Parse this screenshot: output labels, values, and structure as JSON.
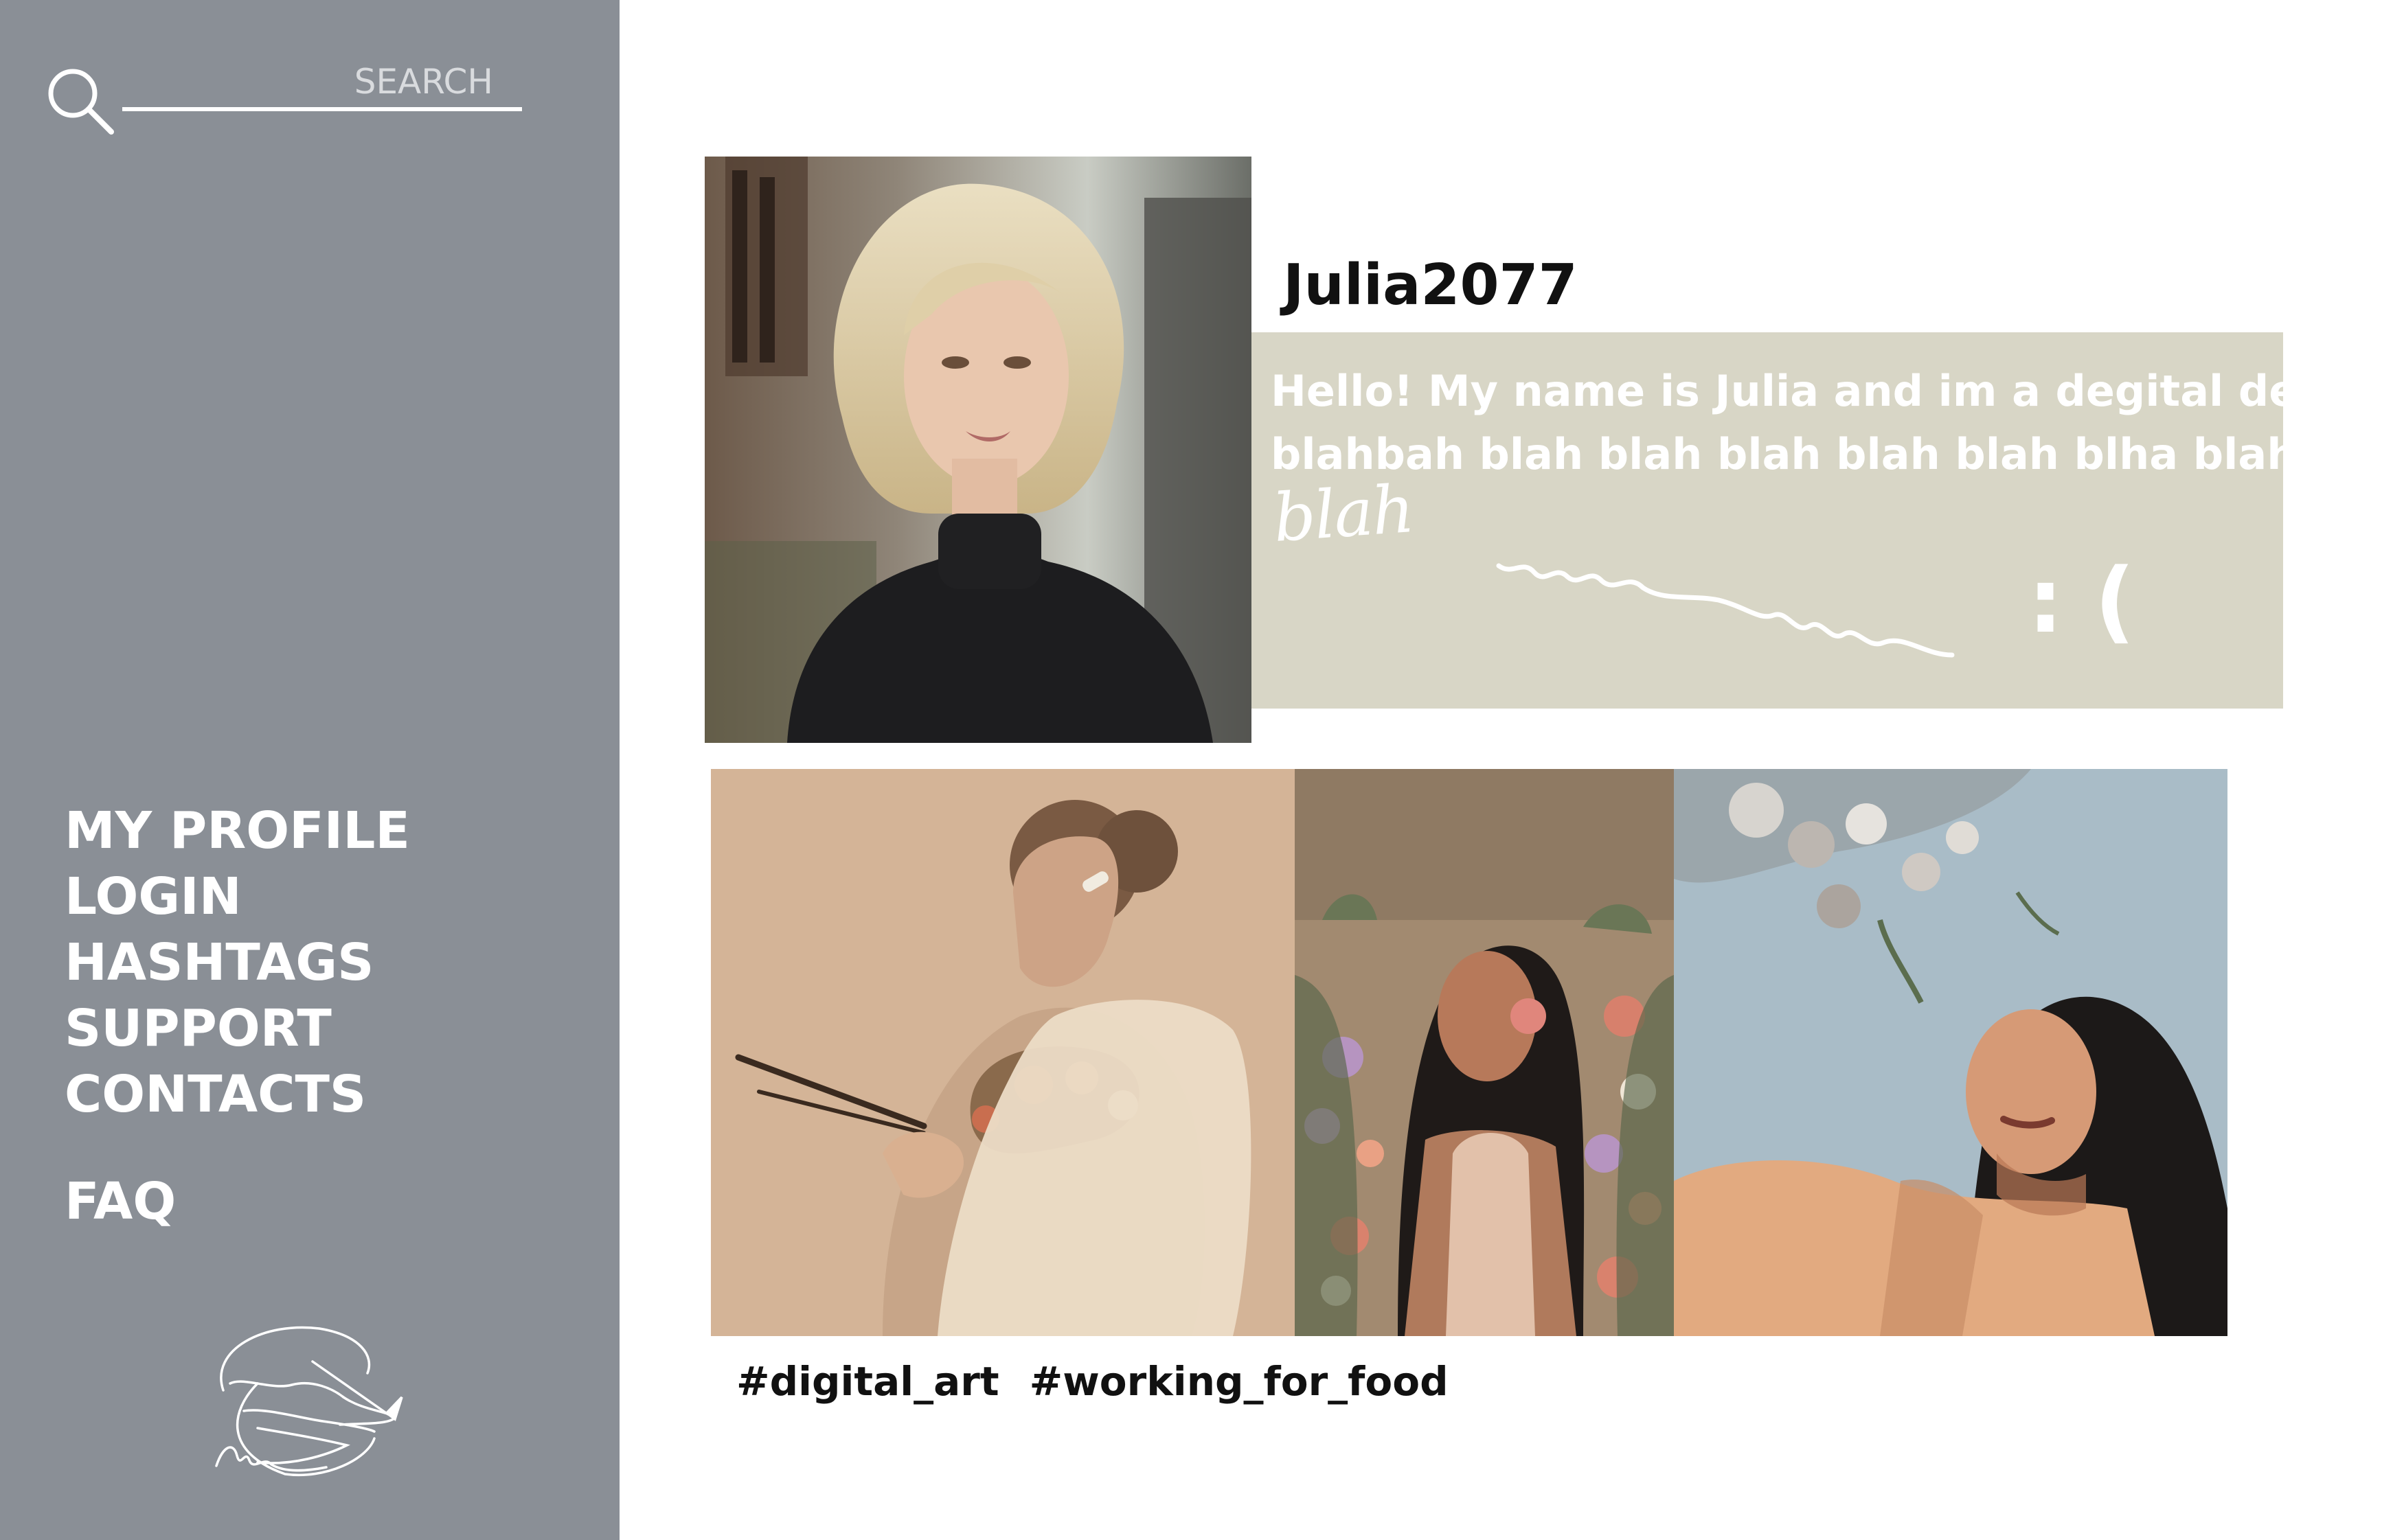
{
  "search": {
    "placeholder": "SEARCH"
  },
  "nav": {
    "items": [
      "MY PROFILE",
      "LOGIN",
      "HASHTAGS",
      "SUPPORT",
      "CONTACTS"
    ],
    "faq": "FAQ"
  },
  "profile": {
    "username": "Julia2077",
    "bio_line_1": "Hello! My name is Julia and im a degital designer!",
    "bio_line_2": "blahbah blah blah blah blah blah blha blahahajhf",
    "scribble": "blah",
    "emoticon": ": ("
  },
  "gallery": {
    "images": [
      "painter-illustration",
      "flower-girl-illustration",
      "sunlit-woman-illustration"
    ]
  },
  "hashtags": [
    "#digital_art",
    "#working_for_food"
  ],
  "colors": {
    "sidebar": "#8a8f96",
    "bio_box": "#d8d6c6",
    "text_dark": "#111111",
    "text_light": "#ffffff"
  }
}
